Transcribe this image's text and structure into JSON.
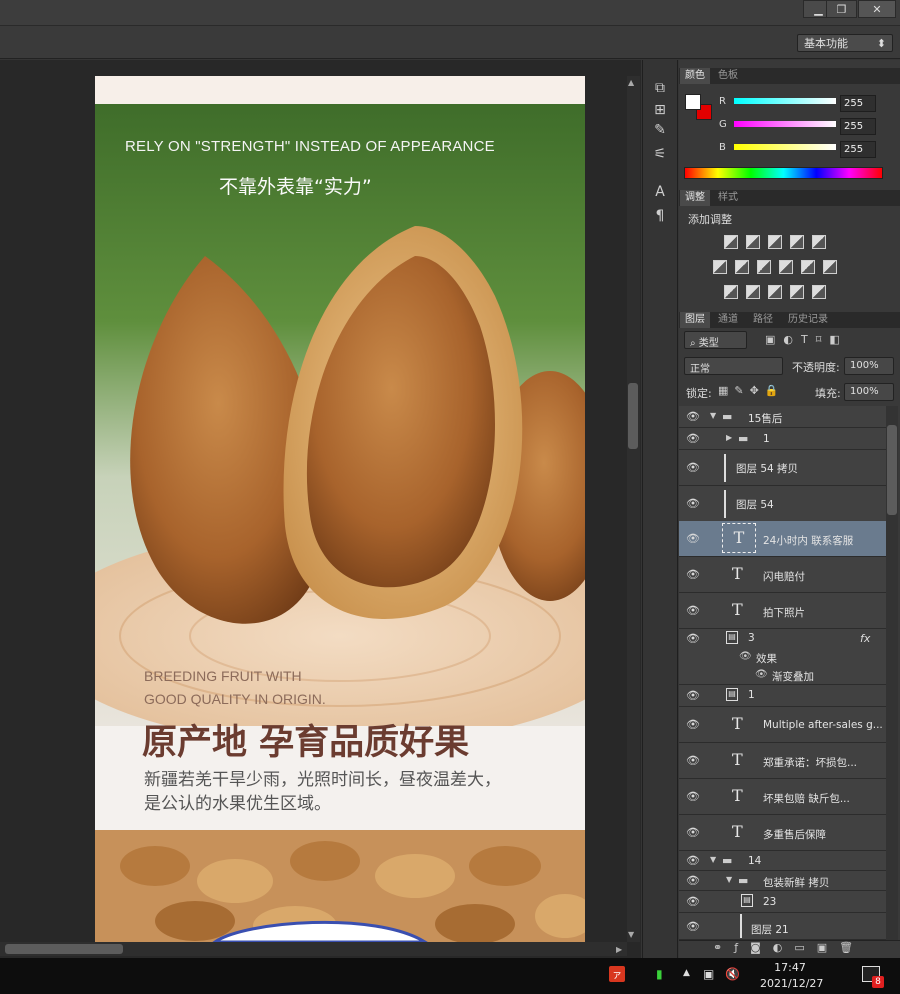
{
  "window": {
    "min_label": "▁",
    "restore_label": "❐",
    "close_label": "✕"
  },
  "optionsbar": {
    "workspace": "基本功能"
  },
  "document": {
    "headline_en": "RELY ON \"STRENGTH\" INSTEAD OF APPEARANCE",
    "headline_cn": "不靠外表靠“实力”",
    "sub_en_1": "BREEDING FRUIT WITH",
    "sub_en_2": "GOOD QUALITY IN ORIGIN.",
    "title_cn": "原产地 孕育品质好果",
    "desc_line1": "新疆若羌干旱少雨，光照时间长，昼夜温差大，",
    "desc_line2": "是公认的水果优生区域。"
  },
  "color_panel": {
    "tabs": [
      "颜色",
      "色板"
    ],
    "channels": [
      {
        "label": "R",
        "value": "255"
      },
      {
        "label": "G",
        "value": "255"
      },
      {
        "label": "B",
        "value": "255"
      }
    ]
  },
  "adjust_panel": {
    "tabs": [
      "调整",
      "样式"
    ],
    "title": "添加调整"
  },
  "layers_panel": {
    "tabs": [
      "图层",
      "通道",
      "路径",
      "历史记录"
    ],
    "filter_kind": "类型",
    "blend_mode": "正常",
    "opacity_label": "不透明度:",
    "opacity": "100%",
    "lock_label": "锁定:",
    "fill_label": "填充:",
    "fill": "100%",
    "fx_label": "fx",
    "effects_label": "效果",
    "gradient_overlay": "渐变叠加",
    "layers": [
      {
        "name": "15售后"
      },
      {
        "name": "1"
      },
      {
        "name": "图层 54 拷贝"
      },
      {
        "name": "图层 54"
      },
      {
        "name": "24小时内 联系客服"
      },
      {
        "name": "闪电赔付"
      },
      {
        "name": "拍下照片"
      },
      {
        "name": "3"
      },
      {
        "name": "1"
      },
      {
        "name": "Multiple after-sales g..."
      },
      {
        "name": "郑重承诺：坏损包..."
      },
      {
        "name": "坏果包赔  缺斤包..."
      },
      {
        "name": "多重售后保障"
      },
      {
        "name": "14"
      },
      {
        "name": "包装新鲜 拷贝"
      },
      {
        "name": "23"
      },
      {
        "name": "图层 21"
      }
    ]
  },
  "taskbar": {
    "time": "17:47",
    "date": "2021/12/27",
    "badge": "8"
  }
}
